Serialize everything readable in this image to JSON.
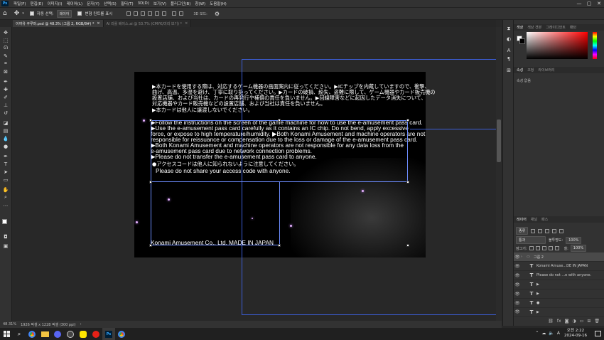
{
  "menu": {
    "logo": "Ps",
    "items": [
      "파일(F)",
      "편집(E)",
      "이미지(I)",
      "레이어(L)",
      "문자(Y)",
      "선택(S)",
      "필터(T)",
      "3D(D)",
      "보기(V)",
      "플러그인(B)",
      "창(W)",
      "도움말(H)"
    ],
    "window_min": "—",
    "window_max": "▢",
    "window_close": "✕"
  },
  "options": {
    "auto_select_label": "자동 선택:",
    "auto_select_value": "레이어",
    "transform_label": "변형 컨트롤 표시"
  },
  "tabs": [
    {
      "label": "이야유 쿠루마.psd @ 48.3% (그룹 2, RGB/8#) *",
      "close": "×"
    },
    {
      "label": "AI 리롤 베이스.ai @ 53.7% (CMYK/미리 보기) *",
      "close": "×"
    }
  ],
  "document": {
    "jp_lines": [
      "▶本カードを使用する際は、対応するゲーム機器の画面案内に従ってください。▶ICチップを内蔵していますので、衝撃、",
      "曲げ、高温、多湿を避け、丁寧に取り扱ってください。▶カードの破損、紛失、盗難に際して、ゲーム機器やカード販売機の",
      "設置店舗、および当社は、カードの再発行や補償の責任を負いません。▶回線障害などに起因したデータ消失について、",
      "対応機器やカード販売機などの設置店舗、および当社は責任を負いません。",
      "▶本カードは他人に譲渡しないでください。"
    ],
    "en_lines": [
      "▶Follow the instructions on the screen of the game machine for how to use the e-amusement pass card.",
      "▶Use the e-amusement pass card carefully as it contains an IC chip. Do not bend, apply excessive",
      "force, or expose to high temperature/humidity. ▶Both Konami Amusement and machine operators are not",
      "responsible for reissuance or compensation due to the loss or damage of the e-amusement pass card.",
      "▶Both Konami Amusement and machine operators are not responsible for any data loss from the",
      "e-amusement pass card due to network connection problems.",
      "▶Please do not transfer the e-amusement pass card to anyone."
    ],
    "access_jp": "●アクセスコードは他人に知られないように注意してください。",
    "access_en": "Please do not share your access code with anyone.",
    "footer_company": "Konami Amusement Co., Ltd.",
    "footer_made": "MADE IN JAPAN"
  },
  "status": {
    "zoom": "48.31%",
    "size": "1926 픽셀 x 1228 픽셀 (300 ppi)",
    "arrow": "›"
  },
  "right_panel": {
    "color_tabs": [
      "색상",
      "색상 견본",
      "그레이디언트",
      "패턴"
    ],
    "props_tabs": [
      "속성",
      "조정",
      "라이브러리"
    ],
    "props_content": "속성 없음",
    "layers_tabs": [
      "레이어",
      "채널",
      "패스"
    ],
    "kind_filter": "종류",
    "blend_mode": "통과",
    "opacity_label": "불투명도:",
    "opacity_value": "100%",
    "lock_label": "잠그기:",
    "fill_label": "칠:",
    "fill_value": "100%"
  },
  "layers": [
    {
      "type": "group",
      "name": "그룹 2"
    },
    {
      "type": "text",
      "name": "Konami Amuse...DE IN JAPAN"
    },
    {
      "type": "text",
      "name": "Please do not ...e with anyone."
    },
    {
      "type": "text",
      "name": "▶"
    },
    {
      "type": "text",
      "name": "▶"
    },
    {
      "type": "text",
      "name": "●"
    },
    {
      "type": "text",
      "name": "▶"
    }
  ],
  "layer_footer_icons": [
    "link-icon",
    "fx-icon",
    "mask-icon",
    "adjustment-icon",
    "folder-icon",
    "new-layer-icon",
    "trash-icon"
  ],
  "taskbar": {
    "time": "오전 2:22",
    "date": "2024-09-16",
    "apps": [
      "start",
      "search",
      "chrome",
      "file-explorer",
      "discord",
      "obs",
      "kakaotalk",
      "youtube",
      "photoshop",
      "chrome-2"
    ]
  },
  "colors": {
    "ps_blue": "#31a8ff",
    "guide_blue": "#3c5ed8",
    "panel_bg": "#323232",
    "canvas_bg": "#282828"
  }
}
